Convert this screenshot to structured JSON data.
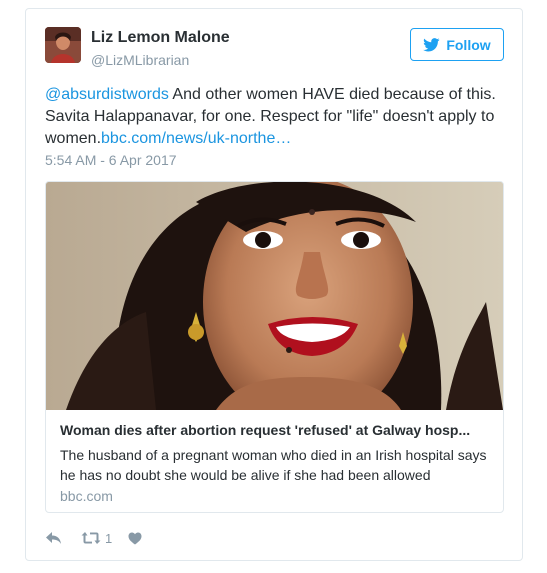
{
  "user": {
    "display_name": "Liz Lemon Malone",
    "handle": "@LizMLibrarian",
    "avatar_icon": "profile-photo"
  },
  "follow_button": {
    "label": "Follow",
    "icon": "twitter-bird-icon",
    "color": "#1da1f2"
  },
  "tweet": {
    "mention": "@absurdistwords",
    "text": " And other women HAVE died because of this. Savita Halappanavar, for one. Respect for \"life\" doesn't apply to women.",
    "link": "bbc.com/news/uk-northe…",
    "timestamp": "5:54 AM - 6 Apr 2017",
    "link_color": "#1b95e0"
  },
  "card": {
    "image_icon": "article-photo",
    "title": "Woman dies after abortion request 'refused' at Galway hosp...",
    "description": "The husband of a pregnant woman who died in an Irish hospital says he has no doubt she would be alive if she had been allowed",
    "domain": "bbc.com"
  },
  "actions": {
    "reply_icon": "reply-icon",
    "retweet_icon": "retweet-icon",
    "retweet_count": "1",
    "like_icon": "heart-icon",
    "icon_color": "#8899a6"
  }
}
